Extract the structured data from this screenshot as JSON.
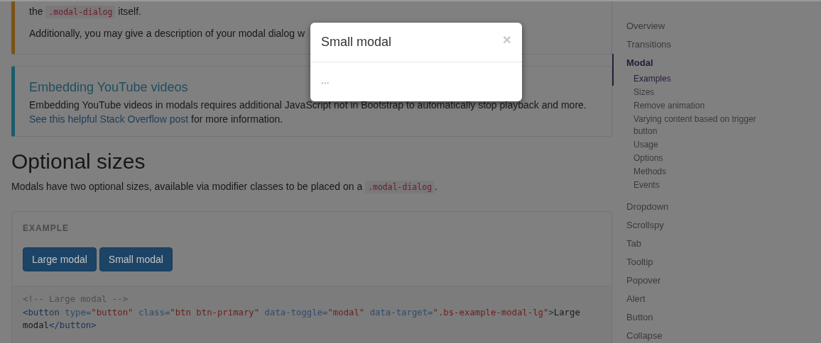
{
  "callouts": [
    {
      "kind": "warning",
      "paragraphs": [
        [
          {
            "kind": "text",
            "text": "the "
          },
          {
            "kind": "code",
            "text": ".modal-dialog"
          },
          {
            "kind": "text",
            "text": " itself."
          }
        ],
        [
          {
            "kind": "text",
            "text": "Additionally, you may give a description of your modal dialog w"
          }
        ]
      ]
    },
    {
      "kind": "info",
      "title": "Embedding YouTube videos",
      "paragraphs": [
        [
          {
            "kind": "text",
            "text": "Embedding YouTube videos in modals requires additional JavaScript not in Bootstrap to automatically stop playback and more. "
          },
          {
            "kind": "link",
            "text": "See this helpful Stack Overflow post"
          },
          {
            "kind": "text",
            "text": " for more information."
          }
        ]
      ]
    }
  ],
  "section": {
    "heading": "Optional sizes",
    "intro": [
      {
        "kind": "text",
        "text": "Modals have two optional sizes, available via modifier classes to be placed on a "
      },
      {
        "kind": "code",
        "text": ".modal-dialog"
      },
      {
        "kind": "text",
        "text": "."
      }
    ]
  },
  "example": {
    "label": "EXAMPLE",
    "buttons": [
      "Large modal",
      "Small modal"
    ],
    "code_lines": [
      [
        {
          "kind": "comment",
          "text": "<!-- Large modal -->"
        }
      ],
      [
        {
          "kind": "tag",
          "text": "<button"
        },
        {
          "kind": "attr",
          "text": " type="
        },
        {
          "kind": "string",
          "text": "\"button\""
        },
        {
          "kind": "attr",
          "text": " class="
        },
        {
          "kind": "string",
          "text": "\"btn btn-primary\""
        },
        {
          "kind": "attr",
          "text": " data-toggle="
        },
        {
          "kind": "string",
          "text": "\"modal\""
        },
        {
          "kind": "attr",
          "text": " data-target="
        },
        {
          "kind": "string",
          "text": "\".bs-example-modal-lg\""
        },
        {
          "kind": "tag",
          "text": ">"
        },
        {
          "kind": "text",
          "text": "Large"
        }
      ],
      [
        {
          "kind": "text",
          "text": "modal"
        },
        {
          "kind": "tag",
          "text": "</button>"
        }
      ]
    ]
  },
  "sidebar": {
    "items": [
      {
        "label": "Overview",
        "selected": false
      },
      {
        "label": "Transitions",
        "selected": false
      },
      {
        "label": "Modal",
        "selected": true,
        "children": [
          {
            "label": "Examples",
            "selected": true
          },
          {
            "label": "Sizes",
            "selected": false
          },
          {
            "label": "Remove animation",
            "selected": false
          },
          {
            "label": "Varying content based on trigger button",
            "selected": false
          },
          {
            "label": "Usage",
            "selected": false
          },
          {
            "label": "Options",
            "selected": false
          },
          {
            "label": "Methods",
            "selected": false
          },
          {
            "label": "Events",
            "selected": false
          }
        ]
      },
      {
        "label": "Dropdown",
        "selected": false
      },
      {
        "label": "Scrollspy",
        "selected": false
      },
      {
        "label": "Tab",
        "selected": false
      },
      {
        "label": "Tooltip",
        "selected": false
      },
      {
        "label": "Popover",
        "selected": false
      },
      {
        "label": "Alert",
        "selected": false
      },
      {
        "label": "Button",
        "selected": false
      },
      {
        "label": "Collapse",
        "selected": false
      }
    ]
  },
  "modal": {
    "title": "Small modal",
    "close": "×",
    "body": "..."
  }
}
